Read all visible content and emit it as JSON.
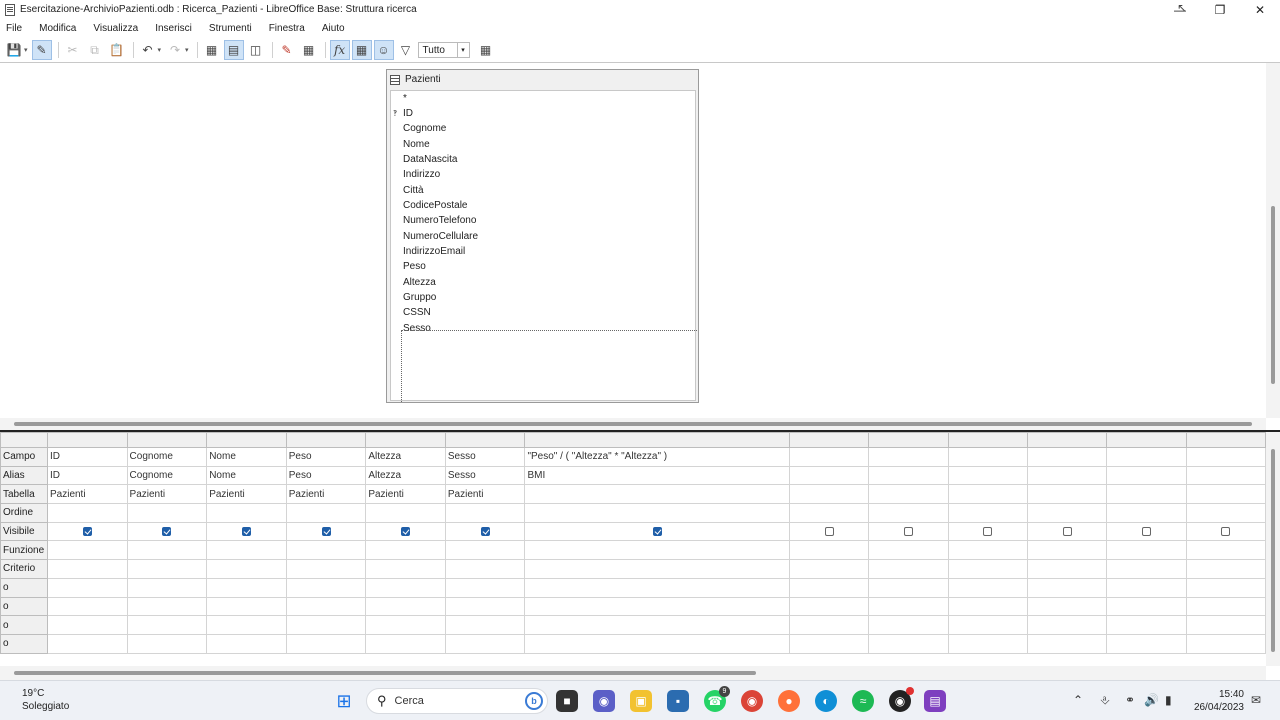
{
  "window": {
    "title": "Esercitazione-ArchivioPazienti.odb : Ricerca_Pazienti - LibreOffice Base: Struttura ricerca"
  },
  "menu": [
    "File",
    "Modifica",
    "Visualizza",
    "Inserisci",
    "Strumenti",
    "Finestra",
    "Aiuto"
  ],
  "toolbar": {
    "limit_value": "Tutto"
  },
  "table_window": {
    "title": "Pazienti",
    "fields": [
      "*",
      "ID",
      "Cognome",
      "Nome",
      "DataNascita",
      "Indirizzo",
      "Città",
      "CodicePostale",
      "NumeroTelefono",
      "NumeroCellulare",
      "IndirizzoEmail",
      "Peso",
      "Altezza",
      "Gruppo",
      "CSSN",
      "Sesso"
    ]
  },
  "grid": {
    "row_headers": [
      "Campo",
      "Alias",
      "Tabella",
      "Ordine",
      "Visibile",
      "Funzione",
      "Criterio",
      "o",
      "o",
      "o",
      "o"
    ],
    "columns": [
      {
        "campo": "ID",
        "alias": "ID",
        "tabella": "Pazienti",
        "visible": true
      },
      {
        "campo": "Cognome",
        "alias": "Cognome",
        "tabella": "Pazienti",
        "visible": true
      },
      {
        "campo": "Nome",
        "alias": "Nome",
        "tabella": "Pazienti",
        "visible": true
      },
      {
        "campo": "Peso",
        "alias": "Peso",
        "tabella": "Pazienti",
        "visible": true
      },
      {
        "campo": "Altezza",
        "alias": "Altezza",
        "tabella": "Pazienti",
        "visible": true
      },
      {
        "campo": "Sesso",
        "alias": "Sesso",
        "tabella": "Pazienti",
        "visible": true
      },
      {
        "campo": "\"Peso\" / ( \"Altezza\" * \"Altezza\" )",
        "alias": "BMI",
        "tabella": "",
        "visible": true
      },
      {
        "campo": "",
        "alias": "",
        "tabella": "",
        "visible": false
      },
      {
        "campo": "",
        "alias": "",
        "tabella": "",
        "visible": false
      },
      {
        "campo": "",
        "alias": "",
        "tabella": "",
        "visible": false
      },
      {
        "campo": "",
        "alias": "",
        "tabella": "",
        "visible": false
      },
      {
        "campo": "",
        "alias": "",
        "tabella": "",
        "visible": false
      },
      {
        "campo": "",
        "alias": "",
        "tabella": "",
        "visible": false
      }
    ]
  },
  "taskbar": {
    "weather_temp": "19°C",
    "weather_desc": "Soleggiato",
    "search_placeholder": "Cerca",
    "whatsapp_badge": "9",
    "time": "15:40",
    "date": "26/04/2023"
  }
}
